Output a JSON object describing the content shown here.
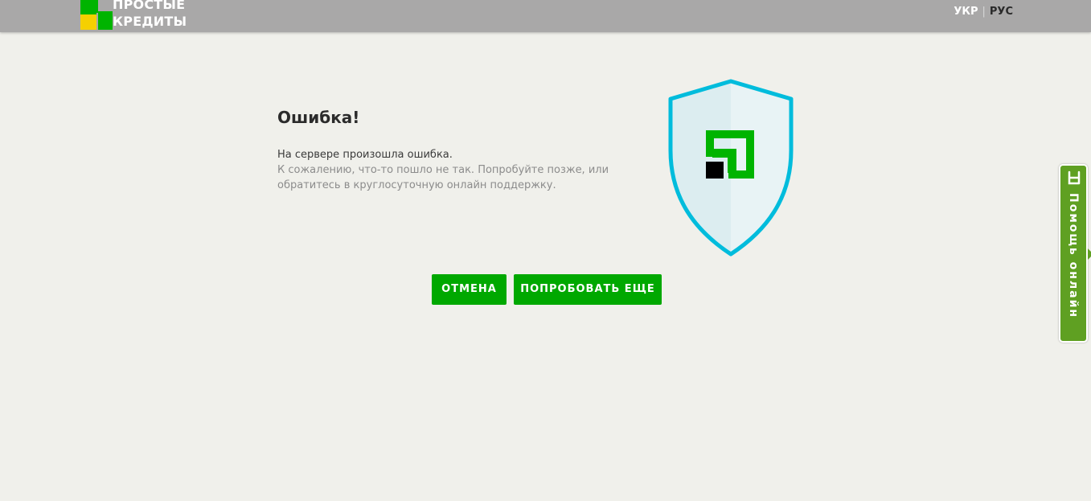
{
  "header": {
    "logo": {
      "line1": "ПРОСТЫЕ",
      "line2": "КРЕДИТЫ"
    },
    "languages": {
      "ukr": "УКР",
      "separator": "|",
      "rus": "РУС"
    }
  },
  "error": {
    "title": "Ошибка!",
    "message": "На сервере произошла ошибка.",
    "details": "К сожалению, что-то пошло не так. Попробуйте позже, или обратитесь в круглосуточную онлайн поддержку."
  },
  "actions": {
    "cancel_label": "ОТМЕНА",
    "retry_label": "ПОПРОБОВАТЬ ЕЩЕ"
  },
  "help_tab": {
    "label": "Помощь онлайн",
    "icon": "chat-bubble-icon"
  },
  "colors": {
    "header_bg": "#a9a8a8",
    "page_bg": "#f0f0eb",
    "button_green": "#00a800",
    "brand_green": "#00b400",
    "shield_blue": "#00bcdc",
    "help_tab_green": "#5fa022",
    "logo_yellow": "#f5d000"
  }
}
